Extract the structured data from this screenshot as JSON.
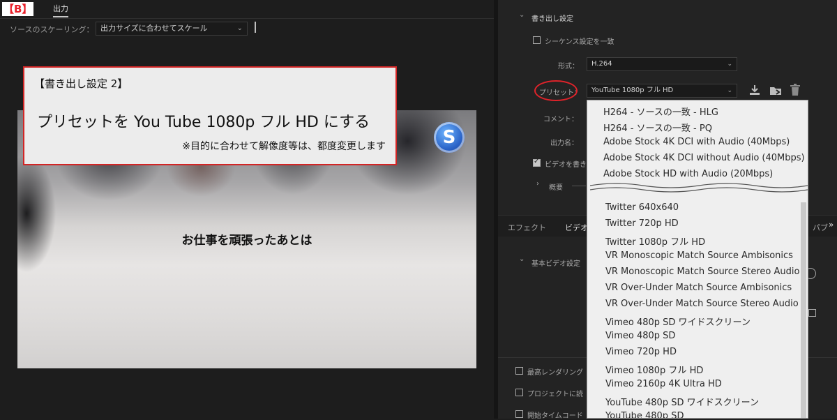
{
  "corner_tag": "【B】",
  "left": {
    "tab_output": "出力",
    "scaling_label": "ソースのスケーリング：",
    "scaling_value": "出力サイズに合わせてスケール",
    "video_caption": "お仕事を頑張ったあとは",
    "logo_letter": "S"
  },
  "annotation": {
    "title": "【書き出し設定 2】",
    "main": "プリセットを You Tube 1080p フル HD にする",
    "note": "※目的に合わせて解像度等は、都度変更します"
  },
  "right": {
    "section_export": "書き出し設定",
    "match_sequence": "シーケンス設定を一致",
    "format_label": "形式：",
    "format_value": "H.264",
    "preset_label": "プリセット：",
    "preset_value": "YouTube  1080p フル HD",
    "comment_label": "コメント：",
    "output_name_label": "出力名：",
    "export_video_partial": "ビデオを書き",
    "summary_label": "概要",
    "tab_effects": "エフェクト",
    "tab_video_partial": "ビデオ",
    "tab_right_partial": "パブ",
    "basic_video_settings": "基本ビデオ設定",
    "max_render_partial": "最高レンダリング",
    "project_partial": "プロジェクトに読",
    "start_timecode_partial": "開始タイムコード",
    "icons": [
      "save-preset-icon",
      "import-preset-icon",
      "delete-preset-icon"
    ]
  },
  "dropdown": {
    "top_items": [
      "H264 - ソースの一致 - HLG",
      "H264 - ソースの一致 - PQ",
      "Adobe Stock 4K DCI with Audio (40Mbps)",
      "Adobe Stock 4K DCI without Audio (40Mbps)",
      "Adobe Stock HD with Audio (20Mbps)"
    ],
    "bottom_items": [
      "Twitter 640x640",
      "Twitter 720p HD",
      "Twitter  1080p フル HD",
      "VR Monoscopic Match Source Ambisonics",
      "VR Monoscopic Match Source Stereo Audio",
      "VR Over-Under Match Source Ambisonics",
      "VR Over-Under Match Source Stereo Audio",
      "Vimeo  480p SD ワイドスクリーン",
      "Vimeo 480p SD",
      "Vimeo 720p HD",
      "Vimeo  1080p フル HD",
      "Vimeo 2160p 4K Ultra HD",
      "YouTube  480p  SD ワイドスクリーン",
      "YouTube 480p SD"
    ]
  },
  "colors": {
    "annotation_border": "#d22525",
    "highlight_circle": "#e0232a",
    "logo_blue": "#2a63c7"
  }
}
